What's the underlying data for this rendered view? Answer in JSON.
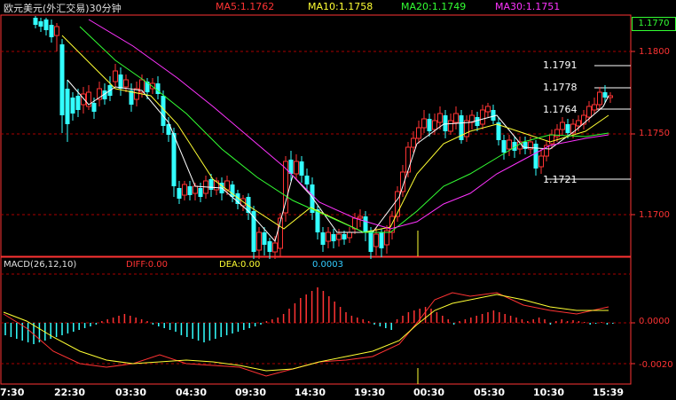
{
  "header": {
    "title": "欧元美元(外汇交易)30分钟",
    "ma5": "MA5:1.1762",
    "ma10": "MA10:1.1758",
    "ma20": "MA20:1.1749",
    "ma30": "MA30:1.1751"
  },
  "current_price": "1.1770",
  "price_axis": [
    "1.1800",
    "1.1750",
    "1.1700"
  ],
  "callouts": [
    "1.1791",
    "1.1778",
    "1.1764",
    "1.1721"
  ],
  "macd_header": {
    "title": "MACD(26,12,10)",
    "diff": "DIFF:0.00",
    "dea": "DEA:0.00",
    "value": "0.0003"
  },
  "macd_axis": [
    "0.0000",
    "-0.0020"
  ],
  "time_axis": [
    "7:30",
    "22:30",
    "03:30",
    "04:30",
    "09:30",
    "14:30",
    "19:30",
    "00:30",
    "05:30",
    "10:30",
    "15:39"
  ],
  "colors": {
    "up": "#ff3333",
    "down": "#33ffff",
    "ma5": "#ffffff",
    "ma10": "#ffff33",
    "ma20": "#33ff33",
    "ma30": "#ff33ff",
    "grid": "#aa0000",
    "axis_text": "#ff3333"
  }
}
